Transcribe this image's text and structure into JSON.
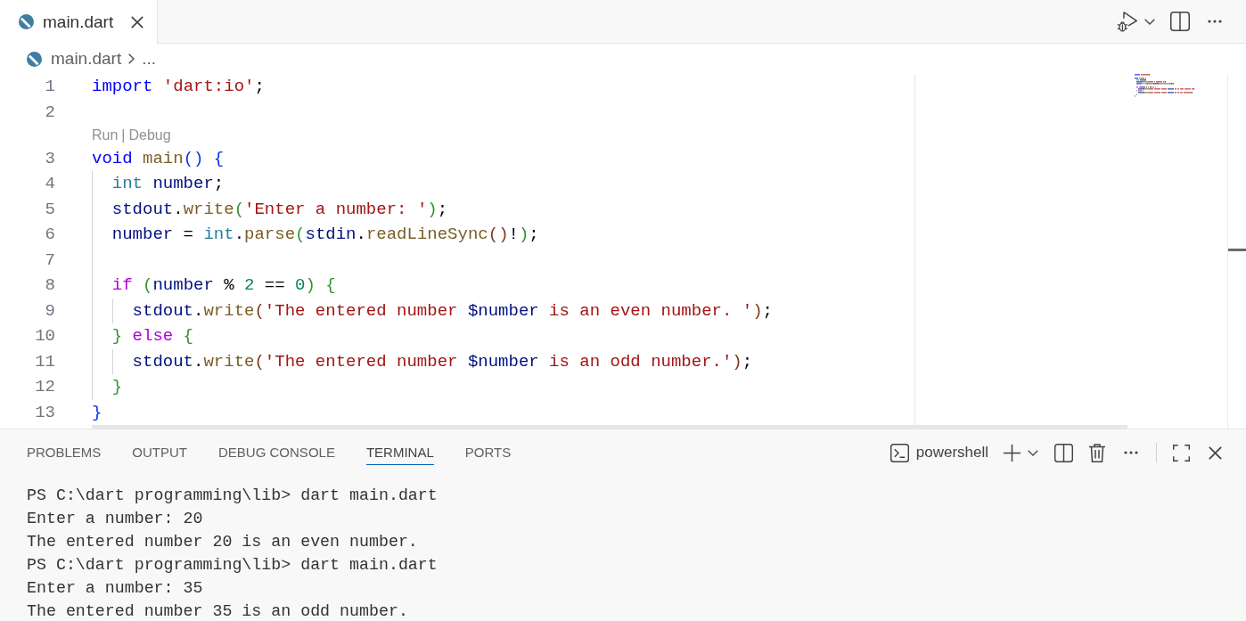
{
  "editor_tabs": [
    {
      "label": "main.dart",
      "selected": true
    }
  ],
  "breadcrumb": [
    {
      "label": "main.dart",
      "kind": "file"
    },
    {
      "label": "...",
      "kind": "more"
    }
  ],
  "editor": {
    "lines": [
      {
        "number": "1",
        "tokens": [
          {
            "text": "import",
            "kind": "keyword"
          },
          {
            "text": " 'dart:io'",
            "kind": "string"
          },
          {
            "text": ";",
            "kind": "plain"
          }
        ]
      },
      {
        "number": "2"
      },
      {
        "number": "3",
        "codelens": {
          "links": [
            "Run",
            "Debug"
          ],
          "separator": "|"
        },
        "tokens": [
          {
            "text": "void",
            "kind": "keyword"
          },
          {
            "text": " main",
            "kind": "function"
          },
          {
            "text": "()",
            "kind": "bracket1"
          },
          {
            "text": " {",
            "kind": "bracket1"
          }
        ],
        "children": [
          {
            "number": "4",
            "tokens": [
              {
                "text": "int",
                "kind": "type"
              },
              {
                "text": " number",
                "kind": "variable"
              },
              {
                "text": ";",
                "kind": "plain"
              }
            ]
          },
          {
            "number": "5",
            "tokens": [
              {
                "text": "stdout",
                "kind": "variable"
              },
              {
                "text": ".",
                "kind": "plain"
              },
              {
                "text": "write",
                "kind": "function"
              },
              {
                "text": "(",
                "kind": "bracket2"
              },
              {
                "text": "'Enter a number: '",
                "kind": "string"
              },
              {
                "text": ")",
                "kind": "bracket2"
              },
              {
                "text": ";",
                "kind": "plain"
              }
            ]
          },
          {
            "number": "6",
            "tokens": [
              {
                "text": "number",
                "kind": "variable"
              },
              {
                "text": " = ",
                "kind": "plain"
              },
              {
                "text": "int",
                "kind": "type"
              },
              {
                "text": ".",
                "kind": "plain"
              },
              {
                "text": "parse",
                "kind": "function"
              },
              {
                "text": "(",
                "kind": "bracket2"
              },
              {
                "text": "stdin",
                "kind": "variable"
              },
              {
                "text": ".",
                "kind": "plain"
              },
              {
                "text": "readLineSync",
                "kind": "function"
              },
              {
                "text": "()",
                "kind": "bracket3"
              },
              {
                "text": "!",
                "kind": "plain"
              },
              {
                "text": ")",
                "kind": "bracket2"
              },
              {
                "text": ";",
                "kind": "plain"
              }
            ]
          },
          {
            "number": "7"
          },
          {
            "number": "8",
            "tokens": [
              {
                "text": "if",
                "kind": "control"
              },
              {
                "text": " (",
                "kind": "bracket2"
              },
              {
                "text": "number",
                "kind": "variable"
              },
              {
                "text": " % ",
                "kind": "plain"
              },
              {
                "text": "2",
                "kind": "number"
              },
              {
                "text": " == ",
                "kind": "plain"
              },
              {
                "text": "0",
                "kind": "number"
              },
              {
                "text": ")",
                "kind": "bracket2"
              },
              {
                "text": " {",
                "kind": "bracket2"
              }
            ],
            "children": [
              {
                "number": "9",
                "tokens": [
                  {
                    "text": "stdout",
                    "kind": "variable"
                  },
                  {
                    "text": ".",
                    "kind": "plain"
                  },
                  {
                    "text": "write",
                    "kind": "function"
                  },
                  {
                    "text": "(",
                    "kind": "bracket3"
                  },
                  {
                    "text": "'The entered number ",
                    "kind": "string"
                  },
                  {
                    "text": "$number",
                    "kind": "variable"
                  },
                  {
                    "text": " is an even number. '",
                    "kind": "string"
                  },
                  {
                    "text": ")",
                    "kind": "bracket3"
                  },
                  {
                    "text": ";",
                    "kind": "plain"
                  }
                ]
              }
            ]
          },
          {
            "number": "10",
            "tokens": [
              {
                "text": "}",
                "kind": "bracket2"
              },
              {
                "text": " else",
                "kind": "control"
              },
              {
                "text": " {",
                "kind": "bracket2"
              }
            ],
            "children": [
              {
                "number": "11",
                "tokens": [
                  {
                    "text": "stdout",
                    "kind": "variable"
                  },
                  {
                    "text": ".",
                    "kind": "plain"
                  },
                  {
                    "text": "write",
                    "kind": "function"
                  },
                  {
                    "text": "(",
                    "kind": "bracket3"
                  },
                  {
                    "text": "'The entered number ",
                    "kind": "string"
                  },
                  {
                    "text": "$number",
                    "kind": "variable"
                  },
                  {
                    "text": " is an odd number.'",
                    "kind": "string"
                  },
                  {
                    "text": ")",
                    "kind": "bracket3"
                  },
                  {
                    "text": ";",
                    "kind": "plain"
                  }
                ]
              }
            ]
          },
          {
            "number": "12",
            "tokens": [
              {
                "text": "}",
                "kind": "bracket2"
              }
            ]
          }
        ]
      },
      {
        "number": "13",
        "tokens": [
          {
            "text": "}",
            "kind": "bracket1"
          }
        ]
      }
    ]
  },
  "panel": {
    "tabs": [
      {
        "label": "PROBLEMS",
        "selected": false
      },
      {
        "label": "OUTPUT",
        "selected": false
      },
      {
        "label": "DEBUG CONSOLE",
        "selected": false
      },
      {
        "label": "TERMINAL",
        "selected": true
      },
      {
        "label": "PORTS",
        "selected": false
      }
    ],
    "terminal_name": "powershell",
    "terminal_lines": [
      "PS C:\\dart programming\\lib> dart main.dart",
      "Enter a number: 20",
      "The entered number 20 is an even number.",
      "PS C:\\dart programming\\lib> dart main.dart",
      "Enter a number: 35",
      "The entered number 35 is an odd number."
    ]
  }
}
